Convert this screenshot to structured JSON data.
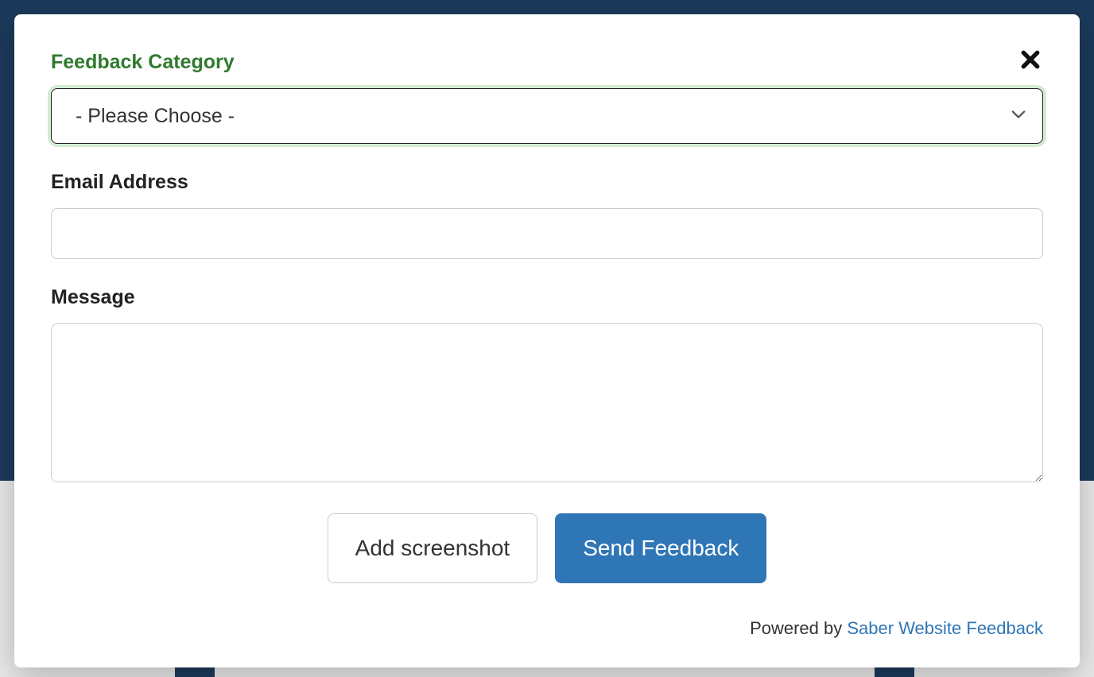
{
  "modal": {
    "close_aria": "Close",
    "category": {
      "label": "Feedback Category",
      "selected": "- Please Choose -"
    },
    "email": {
      "label": "Email Address",
      "value": ""
    },
    "message": {
      "label": "Message",
      "value": ""
    },
    "actions": {
      "screenshot_label": "Add screenshot",
      "send_label": "Send Feedback"
    },
    "footer": {
      "prefix": "Powered by ",
      "link_text": "Saber Website Feedback"
    }
  }
}
